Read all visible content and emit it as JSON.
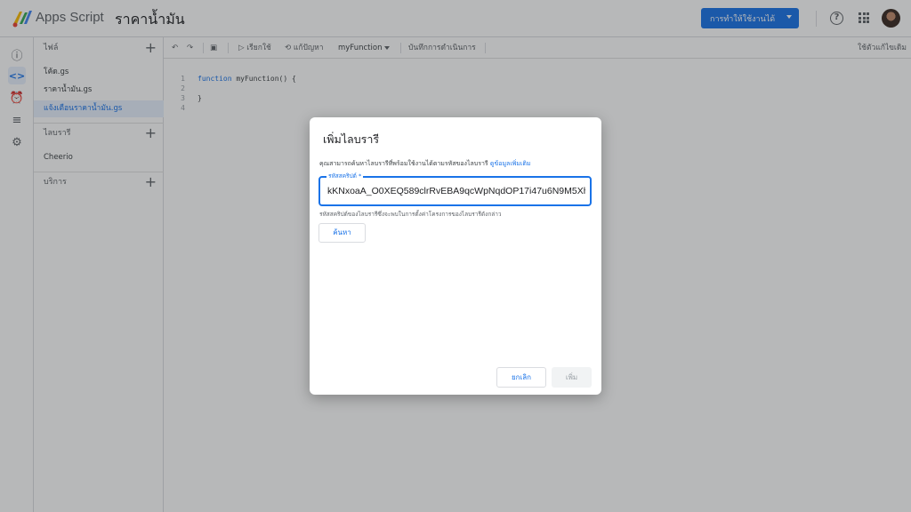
{
  "app": {
    "name": "Apps Script",
    "project_title": "ราคาน้ำมัน",
    "deploy_label": "การทำให้ใช้งานได้"
  },
  "sidebar": {
    "files_header": "ไฟล์",
    "files": [
      "โค้ด.gs",
      "ราคาน้ำมัน.gs",
      "แจ้งเตือนราคาน้ำมัน.gs"
    ],
    "libraries_header": "ไลบรารี",
    "libraries": [
      "Cheerio"
    ],
    "services_header": "บริการ"
  },
  "toolbar": {
    "run_label": "เรียกใช้",
    "debug_label": "แก้ปัญหา",
    "function_name": "myFunction",
    "execution_log_label": "บันทึกการดำเนินการ",
    "legacy_editor_label": "ใช้ตัวแก้ไขเดิม"
  },
  "editor": {
    "lines": [
      {
        "num": "1",
        "code_kw": "function",
        "code_rest": " myFunction() {"
      },
      {
        "num": "2",
        "code_kw": "",
        "code_rest": ""
      },
      {
        "num": "3",
        "code_kw": "",
        "code_rest": "}"
      },
      {
        "num": "4",
        "code_kw": "",
        "code_rest": ""
      }
    ]
  },
  "dialog": {
    "title": "เพิ่มไลบรารี",
    "description": "คุณสามารถค้นหาไลบรารีที่พร้อมใช้งานได้ตามรหัสของไลบรารี",
    "learn_more": "ดูข้อมูลเพิ่มเติม",
    "field_label": "รหัสสคริปต์ *",
    "field_value": "kKNxoaA_O0XEQ589clrRvEBA9qcWpNqdOP17i47u6N9M5Xh0",
    "field_hint": "รหัสสคริปต์ของไลบรารีซึ่งจะพบในการตั้งค่าโครงการของไลบรารีดังกล่าว",
    "search_label": "ค้นหา",
    "cancel_label": "ยกเลิก",
    "add_label": "เพิ่ม"
  }
}
